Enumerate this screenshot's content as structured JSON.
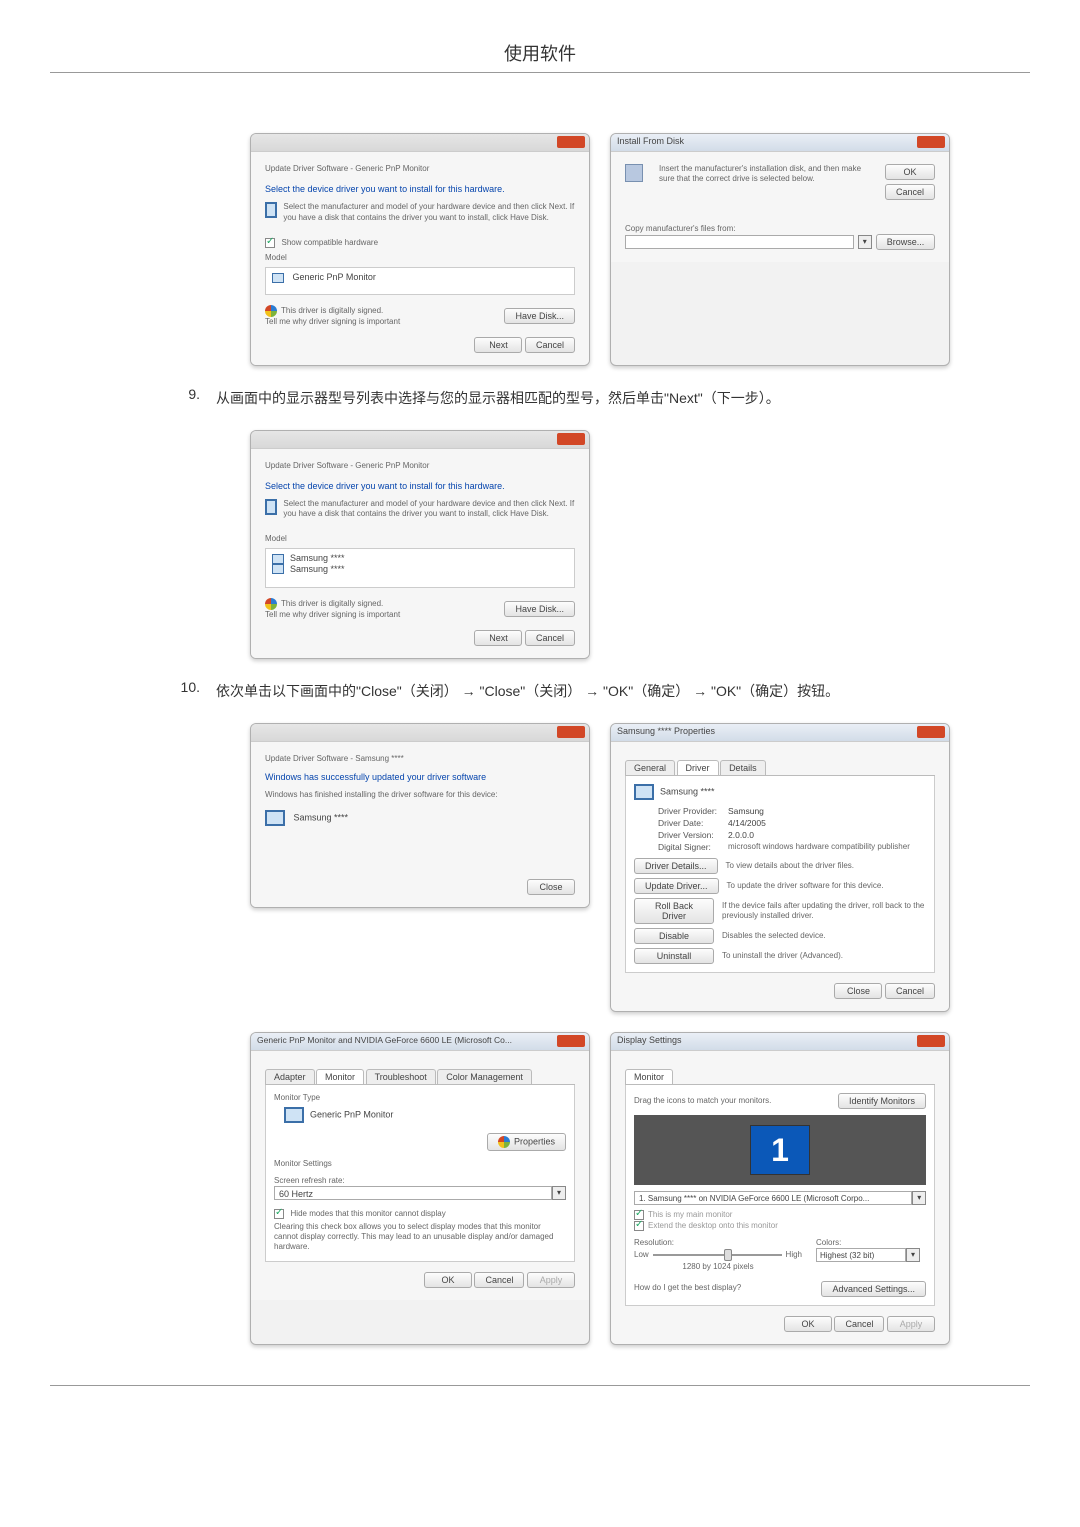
{
  "page_heading": "使用软件",
  "step9": {
    "num": "9.",
    "text": "从画面中的显示器型号列表中选择与您的显示器相匹配的型号，然后单击\"Next\"（下一步）。"
  },
  "step10": {
    "num": "10.",
    "text": "依次单击以下画面中的\"Close\"（关闭） → \"Close\"（关闭） → \"OK\"（确定） → \"OK\"（确定）按钮。"
  },
  "update_driver_win1": {
    "breadcrumb": "Update Driver Software - Generic PnP Monitor",
    "heading": "Select the device driver you want to install for this hardware.",
    "instr": "Select the manufacturer and model of your hardware device and then click Next. If you have a disk that contains the driver you want to install, click Have Disk.",
    "show_compat": "Show compatible hardware",
    "model_label": "Model",
    "model_item": "Generic PnP Monitor",
    "signed": "This driver is digitally signed.",
    "tell_me": "Tell me why driver signing is important",
    "have_disk": "Have Disk...",
    "next": "Next",
    "cancel": "Cancel"
  },
  "install_disk": {
    "title": "Install From Disk",
    "instr": "Insert the manufacturer's installation disk, and then make sure that the correct drive is selected below.",
    "ok": "OK",
    "cancel": "Cancel",
    "copy_label": "Copy manufacturer's files from:",
    "browse": "Browse..."
  },
  "update_driver_win2": {
    "breadcrumb": "Update Driver Software - Generic PnP Monitor",
    "heading": "Select the device driver you want to install for this hardware.",
    "instr": "Select the manufacturer and model of your hardware device and then click Next. If you have a disk that contains the driver you want to install, click Have Disk.",
    "model_label": "Model",
    "model_item1": "Samsung ****",
    "model_item2": "Samsung ****",
    "signed": "This driver is digitally signed.",
    "tell_me": "Tell me why driver signing is important",
    "have_disk": "Have Disk...",
    "next": "Next",
    "cancel": "Cancel"
  },
  "update_success": {
    "breadcrumb": "Update Driver Software - Samsung ****",
    "heading": "Windows has successfully updated your driver software",
    "sub": "Windows has finished installing the driver software for this device:",
    "device": "Samsung ****",
    "close": "Close"
  },
  "properties": {
    "title": "Samsung **** Properties",
    "tab_general": "General",
    "tab_driver": "Driver",
    "tab_details": "Details",
    "device": "Samsung ****",
    "provider_lbl": "Driver Provider:",
    "provider_val": "Samsung",
    "date_lbl": "Driver Date:",
    "date_val": "4/14/2005",
    "version_lbl": "Driver Version:",
    "version_val": "2.0.0.0",
    "signer_lbl": "Digital Signer:",
    "signer_val": "microsoft windows hardware compatibility publisher",
    "btn_details": "Driver Details...",
    "btn_details_desc": "To view details about the driver files.",
    "btn_update": "Update Driver...",
    "btn_update_desc": "To update the driver software for this device.",
    "btn_rollback": "Roll Back Driver",
    "btn_rollback_desc": "If the device fails after updating the driver, roll back to the previously installed driver.",
    "btn_disable": "Disable",
    "btn_disable_desc": "Disables the selected device.",
    "btn_uninstall": "Uninstall",
    "btn_uninstall_desc": "To uninstall the driver (Advanced).",
    "close": "Close",
    "cancel": "Cancel"
  },
  "generic_monitor": {
    "title": "Generic PnP Monitor and NVIDIA GeForce 6600 LE (Microsoft Co...",
    "tab_adapter": "Adapter",
    "tab_monitor": "Monitor",
    "tab_trouble": "Troubleshoot",
    "tab_color": "Color Management",
    "type_label": "Monitor Type",
    "type_val": "Generic PnP Monitor",
    "btn_props": "Properties",
    "settings_label": "Monitor Settings",
    "refresh_label": "Screen refresh rate:",
    "refresh_val": "60 Hertz",
    "hide_modes": "Hide modes that this monitor cannot display",
    "hide_desc": "Clearing this check box allows you to select display modes that this monitor cannot display correctly. This may lead to an unusable display and/or damaged hardware.",
    "ok": "OK",
    "cancel": "Cancel",
    "apply": "Apply"
  },
  "display_settings": {
    "title": "Display Settings",
    "tab_monitor": "Monitor",
    "drag": "Drag the icons to match your monitors.",
    "identify": "Identify Monitors",
    "monitor_num": "1",
    "mon_select": "1. Samsung **** on NVIDIA GeForce 6600 LE (Microsoft Corpo...",
    "main_mon": "This is my main monitor",
    "extend": "Extend the desktop onto this monitor",
    "res_label": "Resolution:",
    "low": "Low",
    "high": "High",
    "res_val": "1280 by 1024 pixels",
    "colors_label": "Colors:",
    "colors_val": "Highest (32 bit)",
    "best": "How do I get the best display?",
    "advanced": "Advanced Settings...",
    "ok": "OK",
    "cancel": "Cancel",
    "apply": "Apply"
  }
}
